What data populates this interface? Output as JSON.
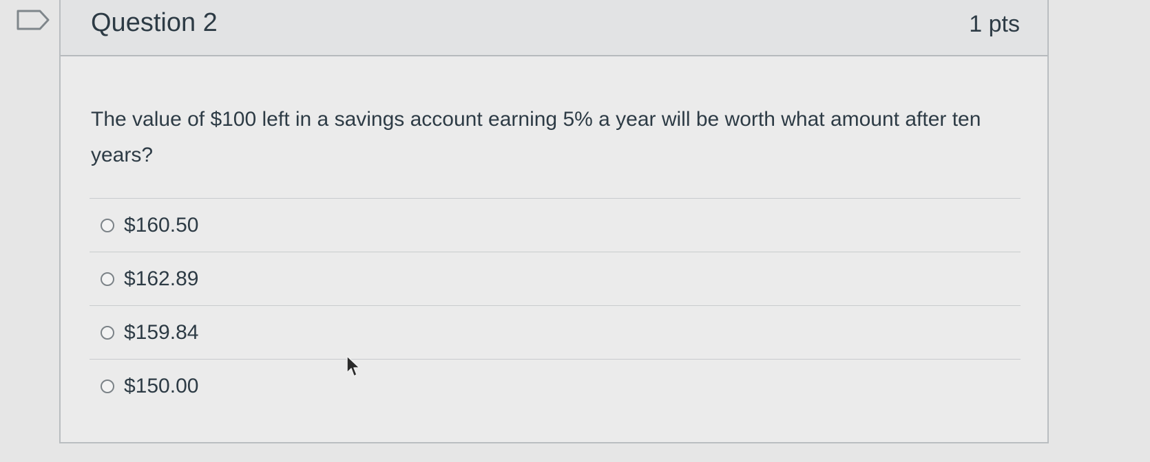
{
  "question": {
    "title": "Question 2",
    "points": "1 pts",
    "text": "The value of $100 left in a savings account earning 5% a year will be worth what amount after ten years?",
    "answers": [
      {
        "label": "$160.50"
      },
      {
        "label": "$162.89"
      },
      {
        "label": "$159.84"
      },
      {
        "label": "$150.00"
      }
    ]
  },
  "colors": {
    "text": "#2d3b45",
    "background": "#e6e6e6",
    "header": "#e2e3e4",
    "border": "#b9bdc0"
  },
  "icons": {
    "flag": "flag-question-icon",
    "cursor": "mouse-pointer-icon",
    "radio": "radio-button-icon"
  }
}
